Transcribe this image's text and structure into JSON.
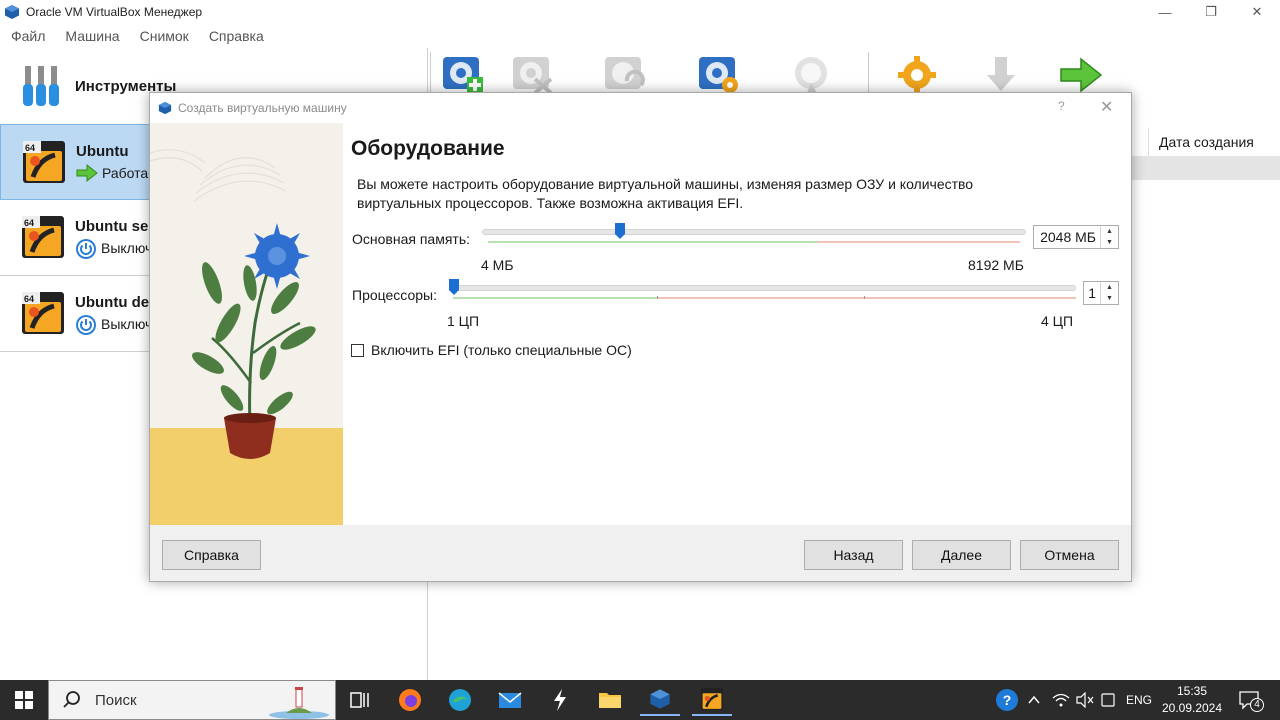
{
  "window": {
    "title": "Oracle VM VirtualBox Менеджер",
    "minimize": "—",
    "restore": "❐",
    "close": "✕"
  },
  "menu": [
    "Файл",
    "Машина",
    "Снимок",
    "Справка"
  ],
  "tools": {
    "label": "Инструменты"
  },
  "vms": [
    {
      "name": "Ubuntu",
      "state": "Работает",
      "badge": "64"
    },
    {
      "name": "Ubuntu se",
      "state": "Выключ",
      "badge": "64"
    },
    {
      "name": "Ubuntu de",
      "state": "Выключ",
      "badge": "64"
    }
  ],
  "details": {
    "column_header": "Дата создания"
  },
  "dialog": {
    "title": "Создать виртуальную машину",
    "help_glyph": "?",
    "close_glyph": "✕",
    "page_title": "Оборудование",
    "description": "Вы можете настроить оборудование виртуальной машины, изменяя размер ОЗУ и количество виртуальных процессоров. Также возможна активация EFI.",
    "memory": {
      "label": "Основная память:",
      "value": "2048 МБ",
      "min_label": "4 МБ",
      "max_label": "8192 МБ",
      "value_mb": 2048,
      "min_mb": 4,
      "max_mb": 8192
    },
    "cpu": {
      "label": "Процессоры:",
      "value": "1",
      "min_label": "1 ЦП",
      "max_label": "4 ЦП",
      "count": 1,
      "min": 1,
      "max": 4
    },
    "efi": {
      "label": "Включить EFI (только специальные ОС)",
      "checked": false
    },
    "buttons": {
      "help": "Справка",
      "back": "Назад",
      "next": "Далее",
      "cancel": "Отмена"
    }
  },
  "taskbar": {
    "search_placeholder": "Поиск",
    "language": "ENG",
    "time": "15:35",
    "date": "20.09.2024",
    "notifications": "4"
  },
  "colors": {
    "selection": "#bcd9f4",
    "slider_good": "#8fd18f",
    "slider_bad": "#f0a89a",
    "taskbar": "#2b2b2b"
  }
}
